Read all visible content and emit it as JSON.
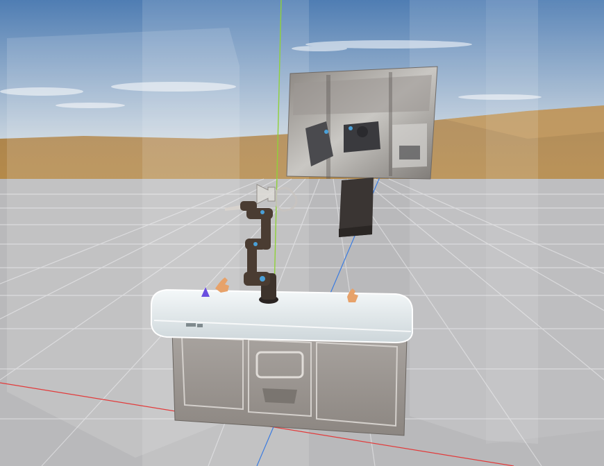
{
  "viewport": {
    "sky_top_color": "#4f7db3",
    "sky_horizon_color": "#c7d3de",
    "desert_color": "#b58a4a",
    "floor_color": "#b9b9bb",
    "grid_color": "#d7d7d9"
  },
  "axes": {
    "x_axis_color": "#e23a3a",
    "y_axis_color": "#8fd13a",
    "z_axis_color": "#3a7be0"
  },
  "objects": {
    "video_panel": {
      "icon": "video-feed-panel"
    },
    "dark_box": {
      "icon": "dark-box",
      "color": "#3a3533"
    },
    "robot_arm": {
      "icon": "robot-arm",
      "color": "#4a3c32"
    },
    "counter": {
      "icon": "lab-counter",
      "top_color": "#e8eef0"
    },
    "move_cursor": {
      "icon": "move-gizmo-icon"
    },
    "left_hand": {
      "icon": "hand-icon",
      "color": "#e7a26a"
    },
    "right_hand": {
      "icon": "hand-icon",
      "color": "#e7a26a"
    },
    "cone_marker": {
      "icon": "purple-cone-icon",
      "color": "#6a4fe0"
    }
  }
}
